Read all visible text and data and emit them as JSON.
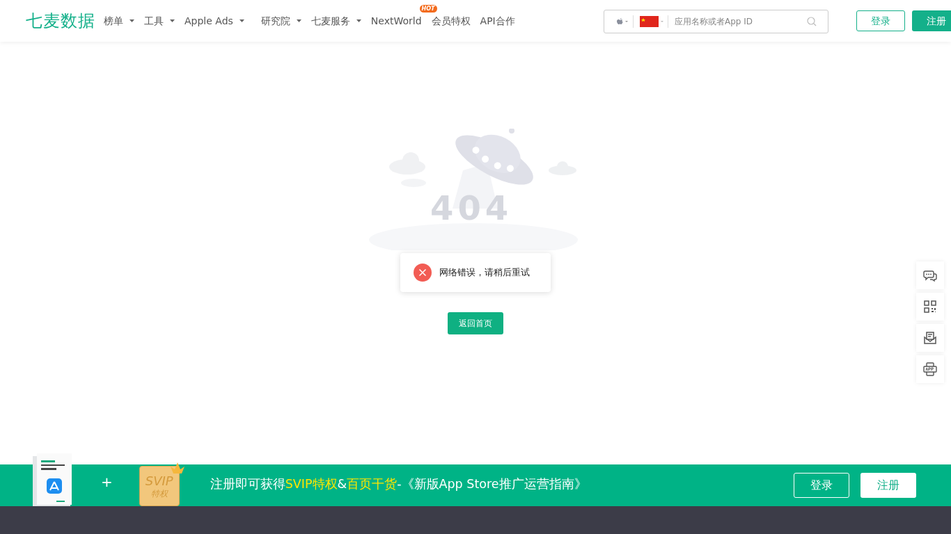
{
  "header": {
    "logo": "七麦数据",
    "nav": [
      {
        "label": "榜单",
        "dropdown": true
      },
      {
        "label": "工具",
        "dropdown": true
      },
      {
        "label": "Apple Ads",
        "dropdown": true
      },
      {
        "label": "研究院",
        "dropdown": true
      },
      {
        "label": "七麦服务",
        "dropdown": true
      },
      {
        "label": "NextWorld",
        "dropdown": false,
        "badge": "HOT"
      },
      {
        "label": "会员特权",
        "dropdown": false
      },
      {
        "label": "API合作",
        "dropdown": false
      }
    ],
    "search": {
      "placeholder": "应用名称或者App ID"
    },
    "buttons": [
      {
        "label": "登录",
        "kind": "outline"
      },
      {
        "label": "注册",
        "kind": "solid"
      }
    ]
  },
  "error_page": {
    "code": "404",
    "toast": "网络错误，请稍后重试",
    "button": "返回首页"
  },
  "side_tools": [
    {
      "kind": "chat"
    },
    {
      "kind": "qrcode"
    },
    {
      "kind": "mail"
    },
    {
      "kind": "app"
    }
  ],
  "promo_banner": {
    "plus": "+",
    "badge": [
      "SVIP",
      "特权"
    ],
    "segments": [
      {
        "text": "注册即可获得",
        "highlight": false
      },
      {
        "text": "SVIP特权",
        "highlight": true
      },
      {
        "text": "&",
        "highlight": false
      },
      {
        "text": "百页干货",
        "highlight": true
      },
      {
        "text": "-《新版App Store推广运营指南》",
        "highlight": false
      }
    ],
    "buttons": [
      {
        "label": "登录",
        "kind": "outline"
      },
      {
        "label": "注册",
        "kind": "solid"
      }
    ]
  }
}
